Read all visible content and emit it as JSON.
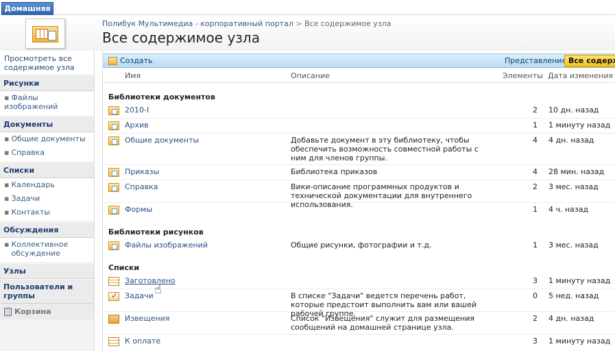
{
  "top_tab": "Домашняя",
  "breadcrumb": {
    "site": "Полибук Мультимедиа - корпоративный портал",
    "sep": ">",
    "current": "Все содержимое узла"
  },
  "page_title": "Все содержимое узла",
  "leftnav": {
    "view_all": "Просмотреть все содержимое узла",
    "groups": [
      {
        "title": "Рисунки",
        "items": [
          "Файлы изображений"
        ]
      },
      {
        "title": "Документы",
        "items": [
          "Общие документы",
          "Справка"
        ]
      },
      {
        "title": "Списки",
        "items": [
          "Календарь",
          "Задачи",
          "Контакты"
        ]
      },
      {
        "title": "Обсуждения",
        "items": [
          "Коллективное обсуждение"
        ]
      },
      {
        "title": "Узлы",
        "items": []
      },
      {
        "title": "Пользователи и группы",
        "items": []
      }
    ],
    "recycle": "Корзина"
  },
  "toolbar": {
    "create": "Создать",
    "view_label": "Представление:",
    "view_value": "Все содерж"
  },
  "columns": {
    "name": "Имя",
    "description": "Описание",
    "items": "Элементы",
    "modified": "Дата изменения"
  },
  "sections": [
    {
      "title": "Библиотеки документов",
      "rows": [
        {
          "name": "2010-I",
          "desc": "",
          "count": "2",
          "date": "10 дн. назад",
          "icon": "folder-icon"
        },
        {
          "name": "Архив",
          "desc": "",
          "count": "1",
          "date": "1 минуту назад",
          "icon": "folder-icon"
        },
        {
          "name": "Общие документы",
          "desc": "Добавьте документ в эту библиотеку, чтобы обеспечить возможность совместной работы с ним для членов группы.",
          "count": "4",
          "date": "4 дн. назад",
          "icon": "folder-icon"
        },
        {
          "name": "Приказы",
          "desc": "Библиотека приказов",
          "count": "4",
          "date": "28 мин. назад",
          "icon": "folder-icon"
        },
        {
          "name": "Справка",
          "desc": "Вики-описание программных продуктов и технической документации для внутреннего использования.",
          "count": "2",
          "date": "3 мес. назад",
          "icon": "folder-icon"
        },
        {
          "name": "Формы",
          "desc": "",
          "count": "1",
          "date": "4 ч. назад",
          "icon": "folder-icon"
        }
      ]
    },
    {
      "title": "Библиотеки рисунков",
      "rows": [
        {
          "name": "Файлы изображений",
          "desc": "Общие рисунки, фотографии и т.д.",
          "count": "1",
          "date": "3 мес. назад",
          "icon": "folder-icon"
        }
      ]
    },
    {
      "title": "Списки",
      "rows": [
        {
          "name": "Заготовлено",
          "desc": "",
          "count": "3",
          "date": "1 минуту назад",
          "icon": "list-icon"
        },
        {
          "name": "Задачи",
          "desc": "В списке \"Задачи\" ведется перечень работ, которые предстоит выполнить вам или вашей рабочей группе.",
          "count": "0",
          "date": "5 нед. назад",
          "icon": "task-icon"
        },
        {
          "name": "Извещения",
          "desc": "Список \"Извещения\" служит для размещения сообщений на домашней странице узла.",
          "count": "2",
          "date": "4 дн. назад",
          "icon": "announcement-icon"
        },
        {
          "name": "К оплате",
          "desc": "",
          "count": "3",
          "date": "1 минуту назад",
          "icon": "list-icon"
        }
      ]
    }
  ]
}
